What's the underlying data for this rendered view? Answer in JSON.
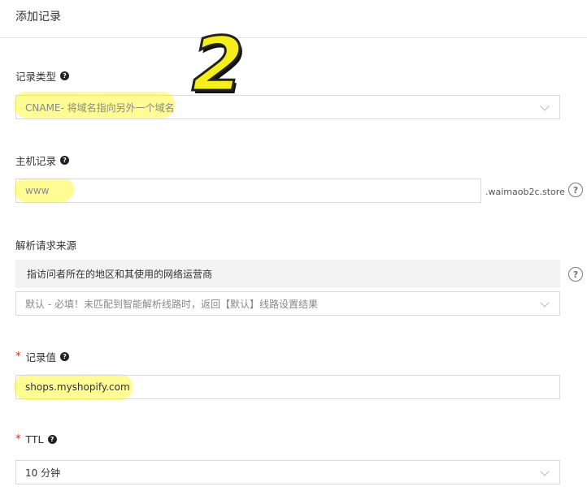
{
  "header": {
    "title": "添加记录"
  },
  "annotation": {
    "step": "2"
  },
  "record_type": {
    "label": "记录类型",
    "help": "?",
    "value": "CNAME- 将域名指向另外一个域名"
  },
  "host_record": {
    "label": "主机记录",
    "help": "?",
    "placeholder": "www",
    "suffix": ".waimaob2c.store",
    "help_circle": "?"
  },
  "resolve_source": {
    "label": "解析请求来源",
    "info": "指访问者所在的地区和其使用的网络运营商",
    "help_circle": "?",
    "value": "默认 - 必填！未匹配到智能解析线路时，返回【默认】线路设置结果"
  },
  "record_value": {
    "required": "*",
    "label": "记录值",
    "help": "?",
    "value": "shops.myshopify.com"
  },
  "ttl": {
    "required": "*",
    "label": "TTL",
    "help": "?",
    "value": "10 分钟"
  },
  "colors": {
    "highlight": "#fffa50",
    "required": "#e0261a",
    "step": "#f5ee1a"
  }
}
